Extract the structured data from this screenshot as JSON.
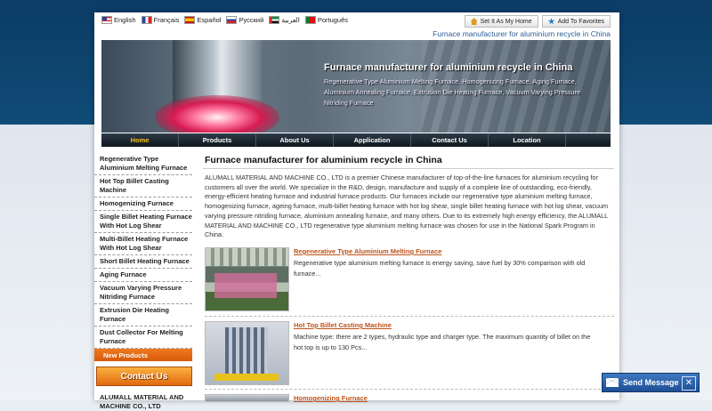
{
  "languages": [
    {
      "label": "English",
      "flag": "en"
    },
    {
      "label": "Français",
      "flag": "fr"
    },
    {
      "label": "Español",
      "flag": "es"
    },
    {
      "label": "Русский",
      "flag": "ru"
    },
    {
      "label": "العربية",
      "flag": "ar"
    },
    {
      "label": "Português",
      "flag": "pt"
    }
  ],
  "top_buttons": {
    "home": "Set It As My Home",
    "favorites": "Add To Favorites"
  },
  "tagline": "Furnace manufacturer for aluminium recycle in China",
  "banner": {
    "title": "Furnace manufacturer for aluminium recycle in China",
    "subtitle": "Regenerative Type Aluminium Melting Furnace, Homogenizing Furnace, Aging Furnace, Aluminium Annealing Furnace, Extrusion Die Heating Furnace, Vacuum Varying Pressure Nitriding Furnace"
  },
  "nav": [
    "Home",
    "Products",
    "About Us",
    "Application",
    "Contact Us",
    "Location"
  ],
  "sidebar": {
    "items": [
      "Regenerative Type Aluminium Melting Furnace",
      "Hot Top Billet Casting Machine",
      "Homogenizing Furnace",
      "Single Billet Heating Furnace With Hot Log Shear",
      "Multi-Billet Heating Furnace With Hot Log Shear",
      "Short Billet Heating Furnace",
      "Aging Furnace",
      "Vacuum Varying Pressure Nitriding Furnace",
      "Extrusion Die Heating Furnace",
      "Dust Collector For Melting Furnace"
    ],
    "new_products": "New Products",
    "contact": "Contact Us",
    "company": "ALUMALL MATERIAL AND MACHINE CO., LTD"
  },
  "main": {
    "title": "Furnace manufacturer for aluminium recycle in China",
    "intro": "ALUMALL MATERIAL AND MACHINE CO., LTD is a premier Chinese manufacturer of top-of-the-line furnaces for aluminium recycling for customers all over the world. We specialize in the R&D, design, manufacture and supply of a complete line of outstanding, eco-friendly, energy-efficient heating furnace and industrial furnace products. Our furnaces include our regenerative type aluminium melting furnace, homogenizing furnace, ageing furnace, multi-billet heating furnace with hot log shear, single billet heating furnace with hot log shear, vacuum varying pressure nitriding furnace, aluminium annealing furnace, and many others. Due to its extremely high energy efficiency, the ALUMALL MATERIAL AND MACHINE CO., LTD regenerative type aluminium melting furnace was chosen for use in the National Spark Program in China.",
    "products": [
      {
        "title": "Regenerative Type Aluminium Melting Furnace",
        "desc": "Regenerative type aluminium melting furnace is energy saving, save fuel by 30% comparison with old furnace..."
      },
      {
        "title": "Hot Top Billet Casting Machine",
        "desc": "Machine type: there are 2 types, hydraulic type and charger type. The maximum quantity of billet on the hot top is up to 130 Pcs..."
      },
      {
        "title": "Homogenizing Furnace",
        "desc": ""
      }
    ]
  },
  "send_message": "Send Message"
}
